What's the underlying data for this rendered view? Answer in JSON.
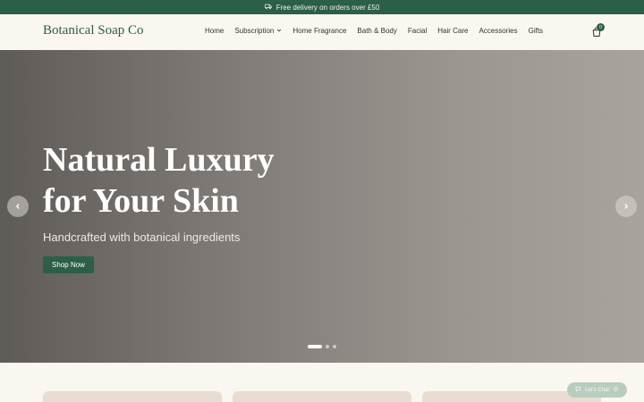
{
  "announcement": {
    "text": "Free delivery on orders over £50"
  },
  "header": {
    "logo": "Botanical Soap Co",
    "nav": [
      {
        "label": "Home"
      },
      {
        "label": "Subscription",
        "has_dropdown": true
      },
      {
        "label": "Home Fragrance"
      },
      {
        "label": "Bath & Body"
      },
      {
        "label": "Facial"
      },
      {
        "label": "Hair Care"
      },
      {
        "label": "Accessories"
      },
      {
        "label": "Gifts"
      }
    ],
    "cart_count": "0"
  },
  "hero": {
    "title": "Natural Luxury for Your Skin",
    "subtitle": "Handcrafted with botanical ingredients",
    "cta": "Shop Now",
    "slides_total": 3,
    "active_slide": 1
  },
  "chat": {
    "label": "Let's Chat"
  },
  "colors": {
    "brand": "#2b5f47",
    "background": "#faf6f0",
    "card": "#e8ddd0"
  }
}
